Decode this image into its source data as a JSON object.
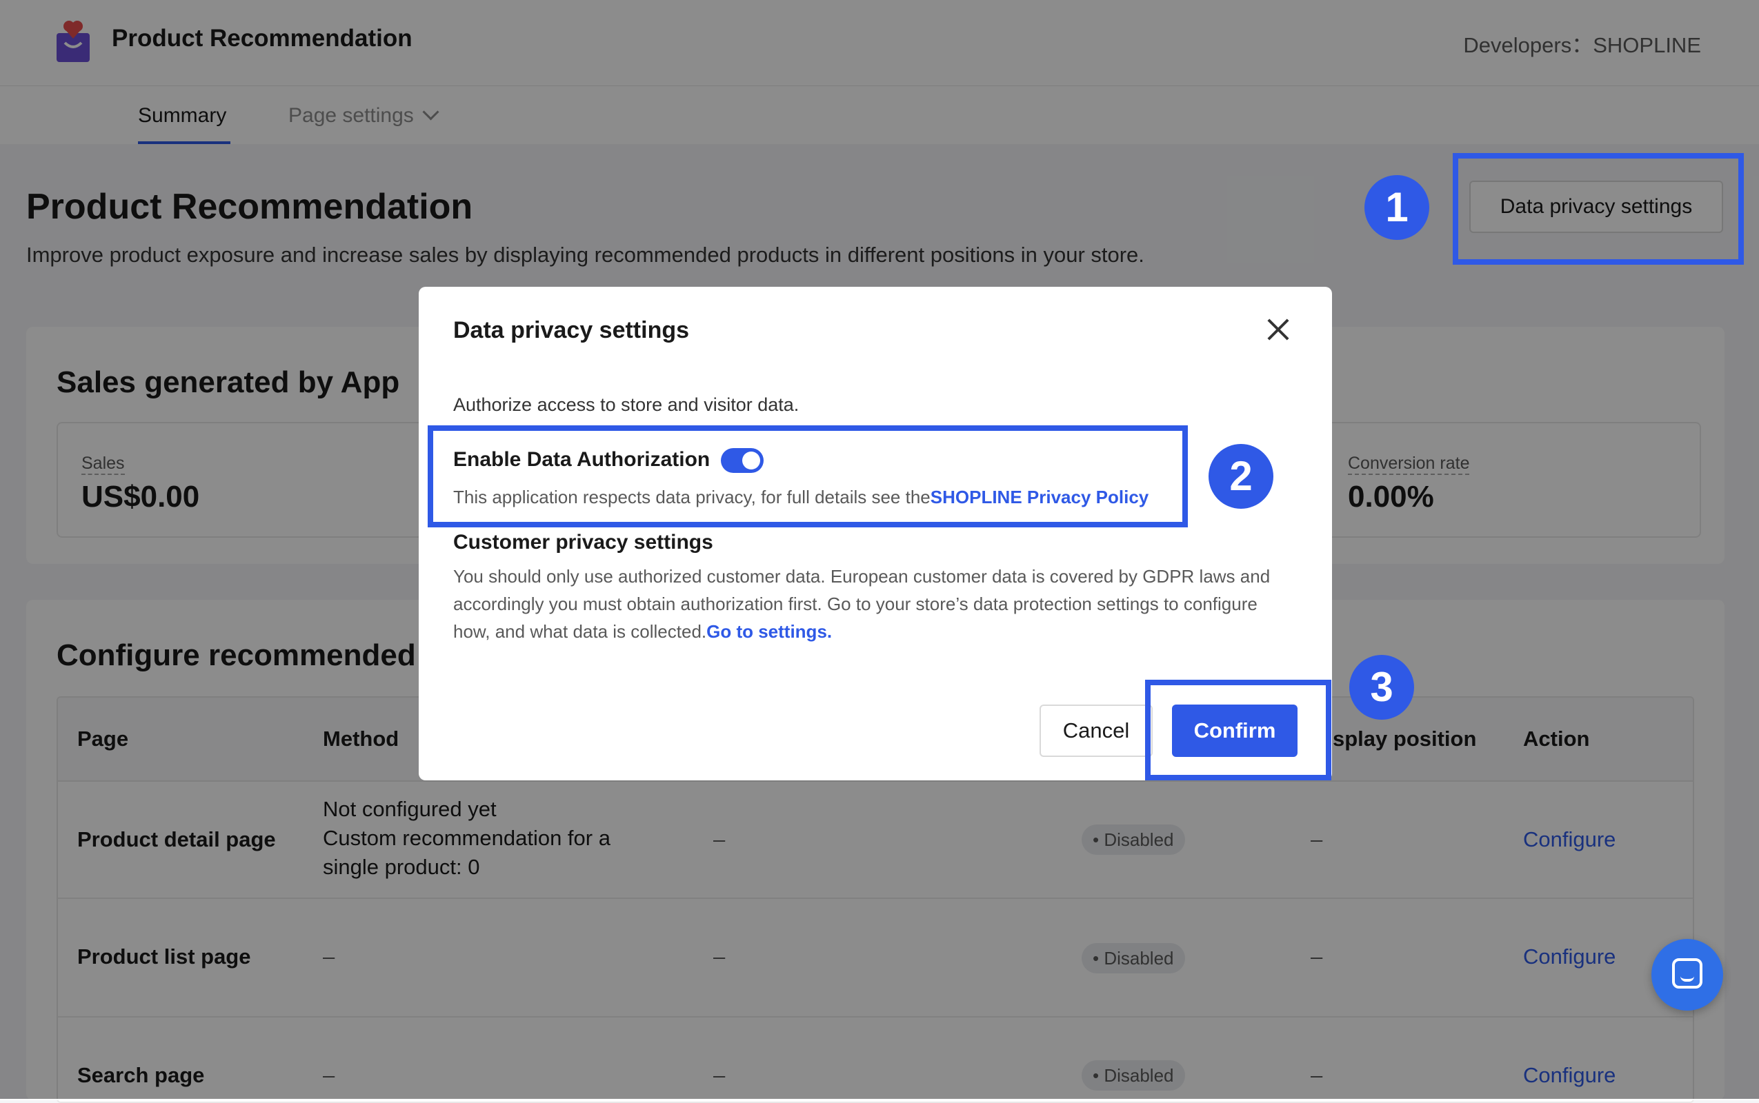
{
  "header": {
    "app_name": "Product Recommendation",
    "developer": "Developers：SHOPLINE"
  },
  "tabs": [
    {
      "label": "Summary",
      "active": true
    },
    {
      "label": "Page settings",
      "active": false
    }
  ],
  "page": {
    "title": "Product Recommendation",
    "description": "Improve product exposure and increase sales by displaying recommended products in different positions in your store.",
    "privacy_button": "Data privacy settings"
  },
  "sales_card": {
    "title": "Sales generated by App",
    "stats": [
      {
        "label": "Sales",
        "value": "US$0.00"
      },
      {
        "label": "Conversion rate",
        "value": "0.00%"
      }
    ]
  },
  "configure_card": {
    "title": "Configure recommended p",
    "columns": [
      "Page",
      "Method",
      "splay position",
      "Action"
    ],
    "rows": [
      {
        "page": "Product detail page",
        "method_lines": [
          "Not configured yet",
          "Custom recommendation for a",
          "single product: 0"
        ],
        "col3": "–",
        "status": "• Disabled",
        "position": "–",
        "action": "Configure"
      },
      {
        "page": "Product list page",
        "method_lines": [
          "–"
        ],
        "col3": "–",
        "status": "• Disabled",
        "position": "–",
        "action": "Configure"
      },
      {
        "page": "Search page",
        "method_lines": [
          "–"
        ],
        "col3": "–",
        "status": "• Disabled",
        "position": "–",
        "action": "Configure"
      }
    ]
  },
  "modal": {
    "title": "Data privacy settings",
    "subtitle": "Authorize access to store and visitor data.",
    "enable_label": "Enable Data Authorization",
    "toggle_on": true,
    "policy_text": "This application respects data privacy, for full details see the",
    "policy_link": "SHOPLINE Privacy Policy",
    "customer_title": "Customer privacy settings",
    "customer_text": "You should only use authorized customer data. European customer data is covered by GDPR laws and accordingly you must obtain authorization first. Go to your store’s data protection settings to configure how, and what data is collected.",
    "customer_link": "Go to settings.",
    "cancel_label": "Cancel",
    "confirm_label": "Confirm"
  },
  "annotations": {
    "badge_1": "1",
    "badge_2": "2",
    "badge_3": "3",
    "color": "#2f59e6"
  },
  "icons": [
    "app-logo-icon",
    "chevron-down-icon",
    "close-icon",
    "chat-icon"
  ]
}
